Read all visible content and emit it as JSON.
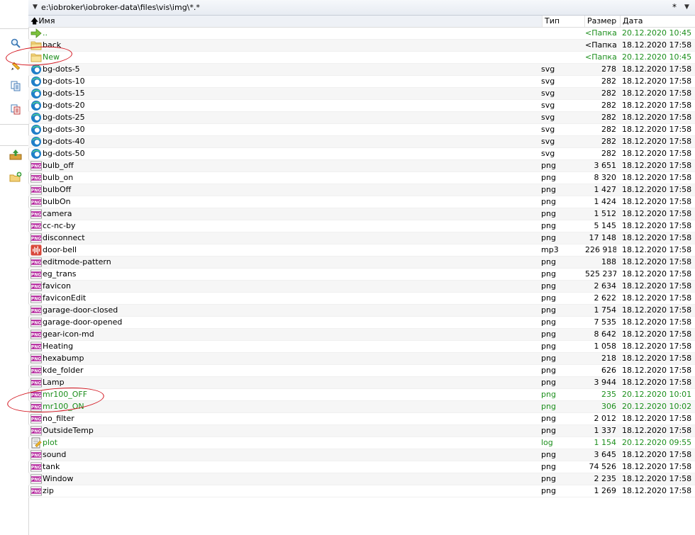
{
  "path_bar": {
    "path": "e:\\iobroker\\iobroker-data\\files\\vis\\img\\*.*",
    "filter_value": "*"
  },
  "columns": {
    "name": "Имя",
    "type": "Тип",
    "size": "Размер",
    "date": "Дата"
  },
  "colors": {
    "green_highlight": "#1c8f1c",
    "annotation_red": "#d3121c",
    "png_badge": "#b3219b"
  },
  "toolbar_icons": [
    "search-icon",
    "edit-icon",
    "copy-icon",
    "move-icon",
    "upload-icon",
    "new-folder-icon"
  ],
  "files": [
    {
      "name": "..",
      "type": "",
      "size": "<Папка>",
      "date": "20.12.2020 10:45",
      "icon": "up",
      "green": true
    },
    {
      "name": "back",
      "type": "",
      "size": "<Папка>",
      "date": "18.12.2020 17:58",
      "icon": "folder",
      "green": false
    },
    {
      "name": "New",
      "type": "",
      "size": "<Папка>",
      "date": "20.12.2020 10:45",
      "icon": "folder",
      "green": true
    },
    {
      "name": "bg-dots-5",
      "type": "svg",
      "size": "278",
      "date": "18.12.2020 17:58",
      "icon": "svg",
      "green": false
    },
    {
      "name": "bg-dots-10",
      "type": "svg",
      "size": "282",
      "date": "18.12.2020 17:58",
      "icon": "svg",
      "green": false
    },
    {
      "name": "bg-dots-15",
      "type": "svg",
      "size": "282",
      "date": "18.12.2020 17:58",
      "icon": "svg",
      "green": false
    },
    {
      "name": "bg-dots-20",
      "type": "svg",
      "size": "282",
      "date": "18.12.2020 17:58",
      "icon": "svg",
      "green": false
    },
    {
      "name": "bg-dots-25",
      "type": "svg",
      "size": "282",
      "date": "18.12.2020 17:58",
      "icon": "svg",
      "green": false
    },
    {
      "name": "bg-dots-30",
      "type": "svg",
      "size": "282",
      "date": "18.12.2020 17:58",
      "icon": "svg",
      "green": false
    },
    {
      "name": "bg-dots-40",
      "type": "svg",
      "size": "282",
      "date": "18.12.2020 17:58",
      "icon": "svg",
      "green": false
    },
    {
      "name": "bg-dots-50",
      "type": "svg",
      "size": "282",
      "date": "18.12.2020 17:58",
      "icon": "svg",
      "green": false
    },
    {
      "name": "bulb_off",
      "type": "png",
      "size": "3 651",
      "date": "18.12.2020 17:58",
      "icon": "png",
      "green": false
    },
    {
      "name": "bulb_on",
      "type": "png",
      "size": "8 320",
      "date": "18.12.2020 17:58",
      "icon": "png",
      "green": false
    },
    {
      "name": "bulbOff",
      "type": "png",
      "size": "1 427",
      "date": "18.12.2020 17:58",
      "icon": "png",
      "green": false
    },
    {
      "name": "bulbOn",
      "type": "png",
      "size": "1 424",
      "date": "18.12.2020 17:58",
      "icon": "png",
      "green": false
    },
    {
      "name": "camera",
      "type": "png",
      "size": "1 512",
      "date": "18.12.2020 17:58",
      "icon": "png",
      "green": false
    },
    {
      "name": "cc-nc-by",
      "type": "png",
      "size": "5 145",
      "date": "18.12.2020 17:58",
      "icon": "png",
      "green": false
    },
    {
      "name": "disconnect",
      "type": "png",
      "size": "17 148",
      "date": "18.12.2020 17:58",
      "icon": "png",
      "green": false
    },
    {
      "name": "door-bell",
      "type": "mp3",
      "size": "226 918",
      "date": "18.12.2020 17:58",
      "icon": "mp3",
      "green": false
    },
    {
      "name": "editmode-pattern",
      "type": "png",
      "size": "188",
      "date": "18.12.2020 17:58",
      "icon": "png",
      "green": false
    },
    {
      "name": "eg_trans",
      "type": "png",
      "size": "525 237",
      "date": "18.12.2020 17:58",
      "icon": "png",
      "green": false
    },
    {
      "name": "favicon",
      "type": "png",
      "size": "2 634",
      "date": "18.12.2020 17:58",
      "icon": "png",
      "green": false
    },
    {
      "name": "faviconEdit",
      "type": "png",
      "size": "2 622",
      "date": "18.12.2020 17:58",
      "icon": "png",
      "green": false
    },
    {
      "name": "garage-door-closed",
      "type": "png",
      "size": "1 754",
      "date": "18.12.2020 17:58",
      "icon": "png",
      "green": false
    },
    {
      "name": "garage-door-opened",
      "type": "png",
      "size": "7 535",
      "date": "18.12.2020 17:58",
      "icon": "png",
      "green": false
    },
    {
      "name": "gear-icon-md",
      "type": "png",
      "size": "8 642",
      "date": "18.12.2020 17:58",
      "icon": "png",
      "green": false
    },
    {
      "name": "Heating",
      "type": "png",
      "size": "1 058",
      "date": "18.12.2020 17:58",
      "icon": "png",
      "green": false
    },
    {
      "name": "hexabump",
      "type": "png",
      "size": "218",
      "date": "18.12.2020 17:58",
      "icon": "png",
      "green": false
    },
    {
      "name": "kde_folder",
      "type": "png",
      "size": "626",
      "date": "18.12.2020 17:58",
      "icon": "png",
      "green": false
    },
    {
      "name": "Lamp",
      "type": "png",
      "size": "3 944",
      "date": "18.12.2020 17:58",
      "icon": "png",
      "green": false
    },
    {
      "name": "mr100_OFF",
      "type": "png",
      "size": "235",
      "date": "20.12.2020 10:01",
      "icon": "png",
      "green": true
    },
    {
      "name": "mr100_ON",
      "type": "png",
      "size": "306",
      "date": "20.12.2020 10:02",
      "icon": "png",
      "green": true
    },
    {
      "name": "no_filter",
      "type": "png",
      "size": "2 012",
      "date": "18.12.2020 17:58",
      "icon": "png",
      "green": false
    },
    {
      "name": "OutsideTemp",
      "type": "png",
      "size": "1 337",
      "date": "18.12.2020 17:58",
      "icon": "png",
      "green": false
    },
    {
      "name": "plot",
      "type": "log",
      "size": "1 154",
      "date": "20.12.2020 09:55",
      "icon": "log",
      "green": true
    },
    {
      "name": "sound",
      "type": "png",
      "size": "3 645",
      "date": "18.12.2020 17:58",
      "icon": "png",
      "green": false
    },
    {
      "name": "tank",
      "type": "png",
      "size": "74 526",
      "date": "18.12.2020 17:58",
      "icon": "png",
      "green": false
    },
    {
      "name": "Window",
      "type": "png",
      "size": "2 235",
      "date": "18.12.2020 17:58",
      "icon": "png",
      "green": false
    },
    {
      "name": "zip",
      "type": "png",
      "size": "1 269",
      "date": "18.12.2020 17:58",
      "icon": "png",
      "green": false
    }
  ]
}
